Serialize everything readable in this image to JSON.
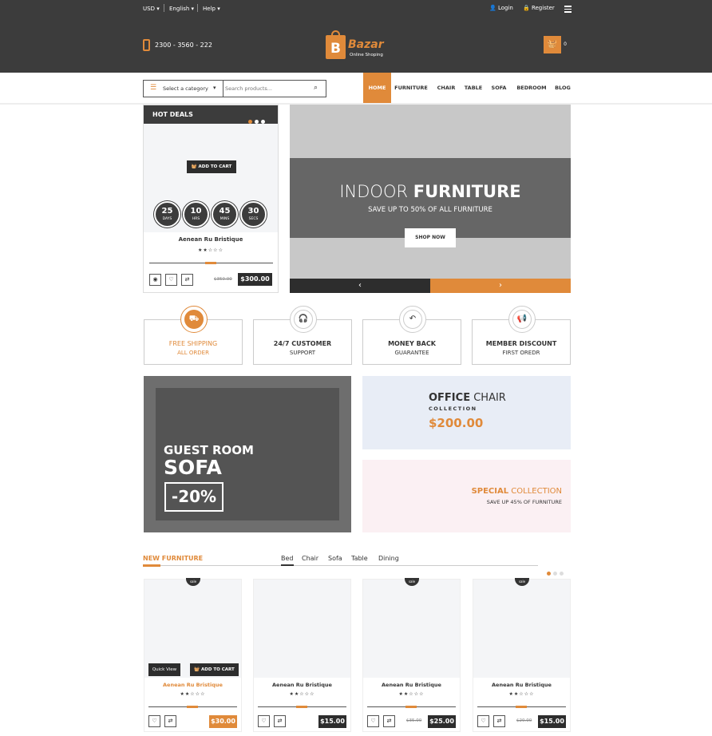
{
  "topbar": {
    "currency": "USD",
    "language": "English",
    "help": "Help",
    "login": "Login",
    "register": "Register"
  },
  "header": {
    "phone": "2300 - 3560 - 222",
    "logo_letter": "B",
    "logo_name": "Bazar",
    "logo_tagline": "Online Shoping",
    "cart_count": "0"
  },
  "search": {
    "category_label": "Select a category",
    "placeholder": "Search products..."
  },
  "nav": [
    "HOME",
    "FURNITURE",
    "CHAIR",
    "TABLE",
    "SOFA",
    "BEDROOM",
    "BLOG"
  ],
  "hot_deals": {
    "title": "HOT DEALS",
    "add_to_cart": "ADD TO CART",
    "countdown": [
      {
        "value": "25",
        "unit": "DAYS"
      },
      {
        "value": "10",
        "unit": "HRS"
      },
      {
        "value": "45",
        "unit": "MINS"
      },
      {
        "value": "30",
        "unit": "SECS"
      }
    ],
    "product_name": "Aenean Ru Bristique",
    "old_price": "$350.00",
    "price": "$300.00",
    "rating": 2
  },
  "hero": {
    "title_light": "INDOOR ",
    "title_bold": "FURNITURE",
    "subtitle": "SAVE UP TO 50% OF ALL FURNITURE",
    "button": "SHOP NOW"
  },
  "features": [
    {
      "line1": "FREE SHIPPING",
      "line2": "ALL ORDER",
      "icon": "truck-icon",
      "active": true
    },
    {
      "line1": "24/7 CUSTOMER",
      "line2": "SUPPORT",
      "icon": "headphones-icon",
      "active": false
    },
    {
      "line1": "MONEY BACK",
      "line2": "GUARANTEE",
      "icon": "money-back-icon",
      "active": false
    },
    {
      "line1": "MEMBER DISCOUNT",
      "line2": "FIRST OREDR",
      "icon": "megaphone-icon",
      "active": false
    }
  ],
  "banners": {
    "guest_line1": "GUEST ROOM",
    "guest_line2": "SOFA",
    "guest_discount": "-20%",
    "office_bold": "OFFICE",
    "office_light": " CHAIR",
    "office_sub": "COLLECTION",
    "office_price": "$200.00",
    "special_bold": "SPECIAL",
    "special_light": " COLLECTION",
    "special_sub": "SAVE UP 45% OF FURNITURE"
  },
  "new_furniture": {
    "title": "NEW FURNITURE",
    "tabs": [
      "Bed",
      "Chair",
      "Sofa",
      "Table",
      "Dining"
    ],
    "quick_view": "Quick View",
    "add_to_cart": "ADD TO CART",
    "sale_label": "sale",
    "products": [
      {
        "name": "Aenean Ru Bristique",
        "price": "$30.00",
        "old_price": "",
        "sale": true,
        "rating": 2
      },
      {
        "name": "Aenean Ru Bristique",
        "price": "$15.00",
        "old_price": "",
        "sale": false,
        "rating": 2
      },
      {
        "name": "Aenean Ru Bristique",
        "price": "$25.00",
        "old_price": "$35.00",
        "sale": true,
        "rating": 2
      },
      {
        "name": "Aenean Ru Bristique",
        "price": "$15.00",
        "old_price": "$20.00",
        "sale": true,
        "rating": 2
      }
    ]
  },
  "colors": {
    "accent": "#e08a3a",
    "dark": "#3c3c3c",
    "office_bg": "#e8edf6",
    "special_bg": "#fbf0f3"
  }
}
